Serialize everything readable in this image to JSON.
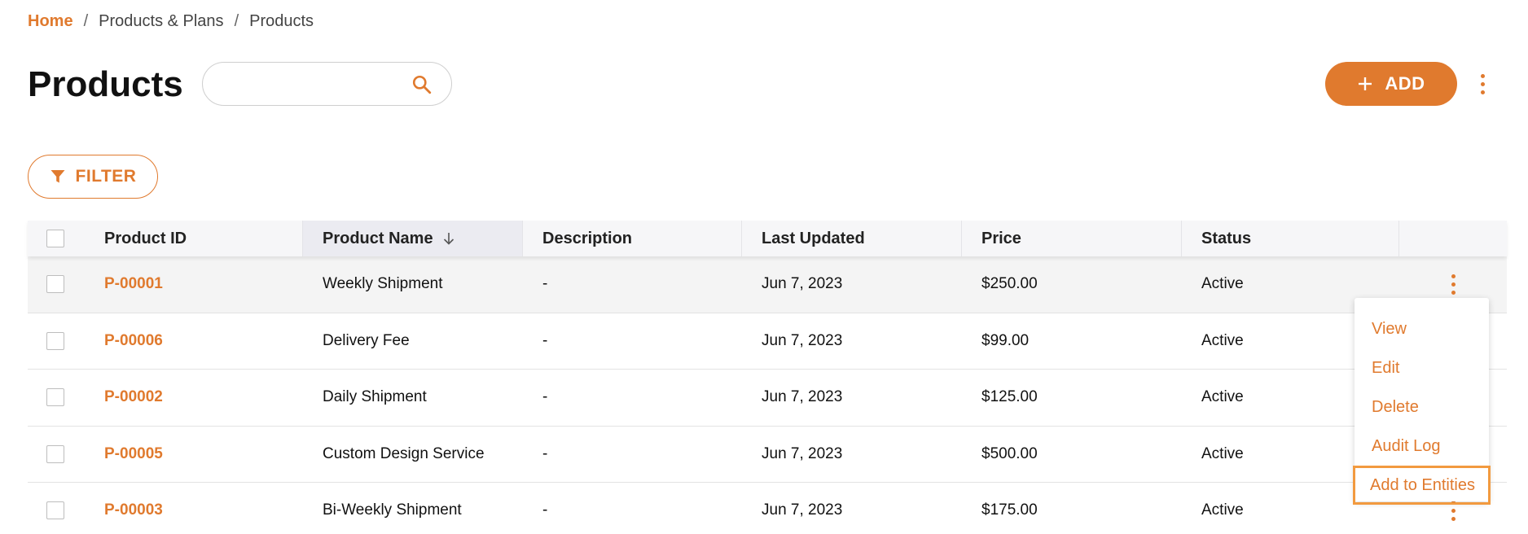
{
  "breadcrumb": {
    "home": "Home",
    "items": [
      "Products & Plans",
      "Products"
    ],
    "separator": "/"
  },
  "page": {
    "title": "Products"
  },
  "search": {
    "placeholder": "",
    "value": "",
    "icon": "search-icon"
  },
  "toolbar": {
    "add_label": "ADD",
    "filter_label": "FILTER"
  },
  "colors": {
    "accent": "#E07A2E",
    "focus_outline": "#F29A3F"
  },
  "table": {
    "columns": {
      "id": "Product ID",
      "name": "Product Name",
      "description": "Description",
      "updated": "Last Updated",
      "price": "Price",
      "status": "Status"
    },
    "sort": {
      "column": "Product Name",
      "direction": "descending"
    },
    "rows": [
      {
        "id": "P-00001",
        "name": "Weekly Shipment",
        "description": "-",
        "updated": "Jun 7, 2023",
        "price": "$250.00",
        "status": "Active"
      },
      {
        "id": "P-00006",
        "name": "Delivery Fee",
        "description": "-",
        "updated": "Jun 7, 2023",
        "price": "$99.00",
        "status": "Active"
      },
      {
        "id": "P-00002",
        "name": "Daily Shipment",
        "description": "-",
        "updated": "Jun 7, 2023",
        "price": "$125.00",
        "status": "Active"
      },
      {
        "id": "P-00005",
        "name": "Custom Design Service",
        "description": "-",
        "updated": "Jun 7, 2023",
        "price": "$500.00",
        "status": "Active"
      },
      {
        "id": "P-00003",
        "name": "Bi-Weekly Shipment",
        "description": "-",
        "updated": "Jun 7, 2023",
        "price": "$175.00",
        "status": "Active"
      }
    ]
  },
  "row_menu": {
    "items": [
      "View",
      "Edit",
      "Delete",
      "Audit Log",
      "Add to Entities"
    ],
    "focused": "Add to Entities"
  }
}
